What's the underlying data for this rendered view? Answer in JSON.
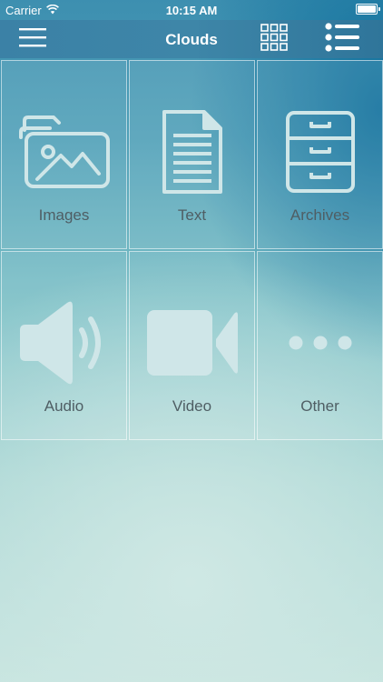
{
  "status_bar": {
    "carrier": "Carrier",
    "time": "10:15 AM"
  },
  "nav": {
    "title": "Clouds",
    "menu_icon": "hamburger-icon",
    "grid_view_icon": "grid-icon",
    "list_view_icon": "list-icon"
  },
  "categories": [
    {
      "label": "Images",
      "icon": "images-icon"
    },
    {
      "label": "Text",
      "icon": "document-icon"
    },
    {
      "label": "Archives",
      "icon": "cabinet-icon"
    },
    {
      "label": "Audio",
      "icon": "speaker-icon"
    },
    {
      "label": "Video",
      "icon": "video-camera-icon"
    },
    {
      "label": "Other",
      "icon": "more-icon"
    }
  ],
  "colors": {
    "nav_bar": "#3e86a8",
    "icon_fill": "#cfe6e8",
    "label_text": "#4f5e64"
  }
}
